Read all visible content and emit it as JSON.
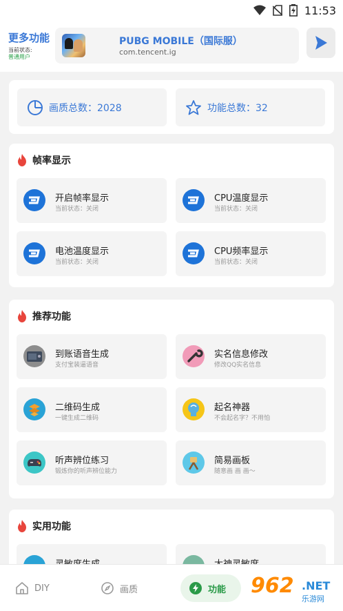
{
  "status_bar": {
    "time": "11:53"
  },
  "header": {
    "more_title": "更多功能",
    "status_label": "当前状态:",
    "user_status": "普通用户",
    "game_title": "PUBG MOBILE（国际服）",
    "game_package": "com.tencent.ig"
  },
  "stats": {
    "quality_label": "画质总数：2028",
    "feature_label": "功能总数：32"
  },
  "fps_section": {
    "title": "帧率显示",
    "items": [
      {
        "title": "开启帧率显示",
        "sub": "当前状态：关闭",
        "icon": "dash-icon"
      },
      {
        "title": "CPU温度显示",
        "sub": "当前状态：关闭",
        "icon": "dash-icon"
      },
      {
        "title": "电池温度显示",
        "sub": "当前状态：关闭",
        "icon": "dash-icon"
      },
      {
        "title": "CPU频率显示",
        "sub": "当前状态：关闭",
        "icon": "dash-icon"
      }
    ]
  },
  "recommend_section": {
    "title": "推荐功能",
    "items": [
      {
        "title": "到账语音生成",
        "sub": "支付宝装逼语音",
        "icon": "radio-icon"
      },
      {
        "title": "实名信息修改",
        "sub": "修改QQ实名信息",
        "icon": "wrench-icon"
      },
      {
        "title": "二维码生成",
        "sub": "一键生成二维码",
        "icon": "qrcode-icon"
      },
      {
        "title": "起名神器",
        "sub": "不会起名字？不用怕",
        "icon": "brain-icon"
      },
      {
        "title": "听声辨位练习",
        "sub": "锻炼你的听声辨位能力",
        "icon": "gamepad-icon"
      },
      {
        "title": "简易画板",
        "sub": "随意画 画 画～",
        "icon": "paint-icon"
      }
    ]
  },
  "utility_section": {
    "title": "实用功能",
    "items": [
      {
        "title": "灵敏度生成",
        "icon": "sensitivity-icon"
      },
      {
        "title": "大神灵敏度",
        "icon": "pro-sensitivity-icon"
      }
    ]
  },
  "bottom_nav": [
    {
      "label": "DIY",
      "icon": "home-icon"
    },
    {
      "label": "画质",
      "icon": "compass-icon"
    },
    {
      "label": "功能",
      "icon": "bolt-icon"
    }
  ],
  "watermark": {
    "num": "962",
    "net": ".NET",
    "cn": "乐游网"
  },
  "colors": {
    "accent_blue": "#3a78d6",
    "active_green": "#2a9a48",
    "flame": "#e8453c",
    "dash_blue": "#1e73d8"
  }
}
